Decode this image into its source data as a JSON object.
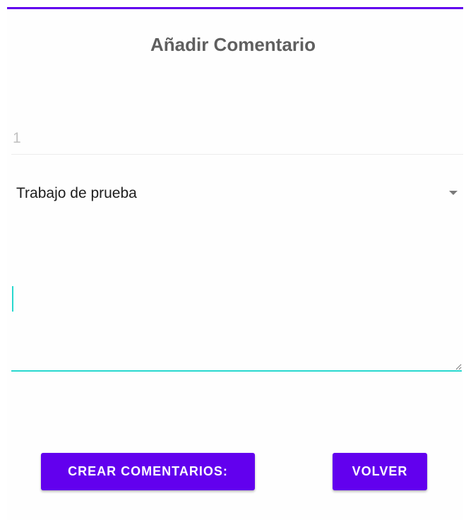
{
  "form": {
    "title": "Añadir Comentario",
    "id_value": "1",
    "job_select": {
      "selected": "Trabajo de prueba",
      "icon": "arrow-drop-down-icon"
    },
    "comment": {
      "value": "",
      "placeholder": ""
    }
  },
  "actions": {
    "create_label": "CREAR COMENTARIOS:",
    "back_label": "VOLVER"
  },
  "colors": {
    "primary": "#6200ee",
    "focus_underline": "#28d8cf",
    "title_text": "#5f5f5f"
  }
}
